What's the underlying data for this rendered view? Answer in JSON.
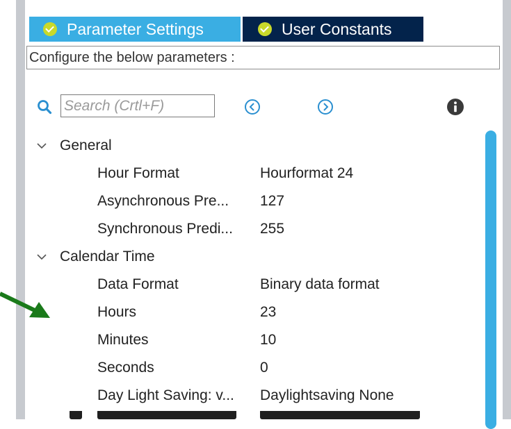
{
  "tabs": [
    {
      "label": "Parameter Settings",
      "icon": "check-circle-icon",
      "color": "#3aaee3"
    },
    {
      "label": "User Constants",
      "icon": "check-circle-icon",
      "color": "#03234b"
    }
  ],
  "config_header": "Configure the below parameters :",
  "search": {
    "placeholder": "Search (Crtl+F)",
    "value": ""
  },
  "colors": {
    "accent": "#3aaee3",
    "dark_tab": "#03234b",
    "check": "#c9d92a",
    "annotation_arrow": "#1a7a1a"
  },
  "groups": [
    {
      "label": "General",
      "params": [
        {
          "name": "Hour Format",
          "value": "Hourformat 24"
        },
        {
          "name": "Asynchronous Pre...",
          "value": "127"
        },
        {
          "name": "Synchronous Predi...",
          "value": "255"
        }
      ]
    },
    {
      "label": "Calendar Time",
      "params": [
        {
          "name": "Data Format",
          "value": "Binary data format"
        },
        {
          "name": "Hours",
          "value": "23"
        },
        {
          "name": "Minutes",
          "value": "10"
        },
        {
          "name": "Seconds",
          "value": "0"
        },
        {
          "name": "Day Light Saving: v...",
          "value": "Daylightsaving None"
        }
      ]
    }
  ]
}
